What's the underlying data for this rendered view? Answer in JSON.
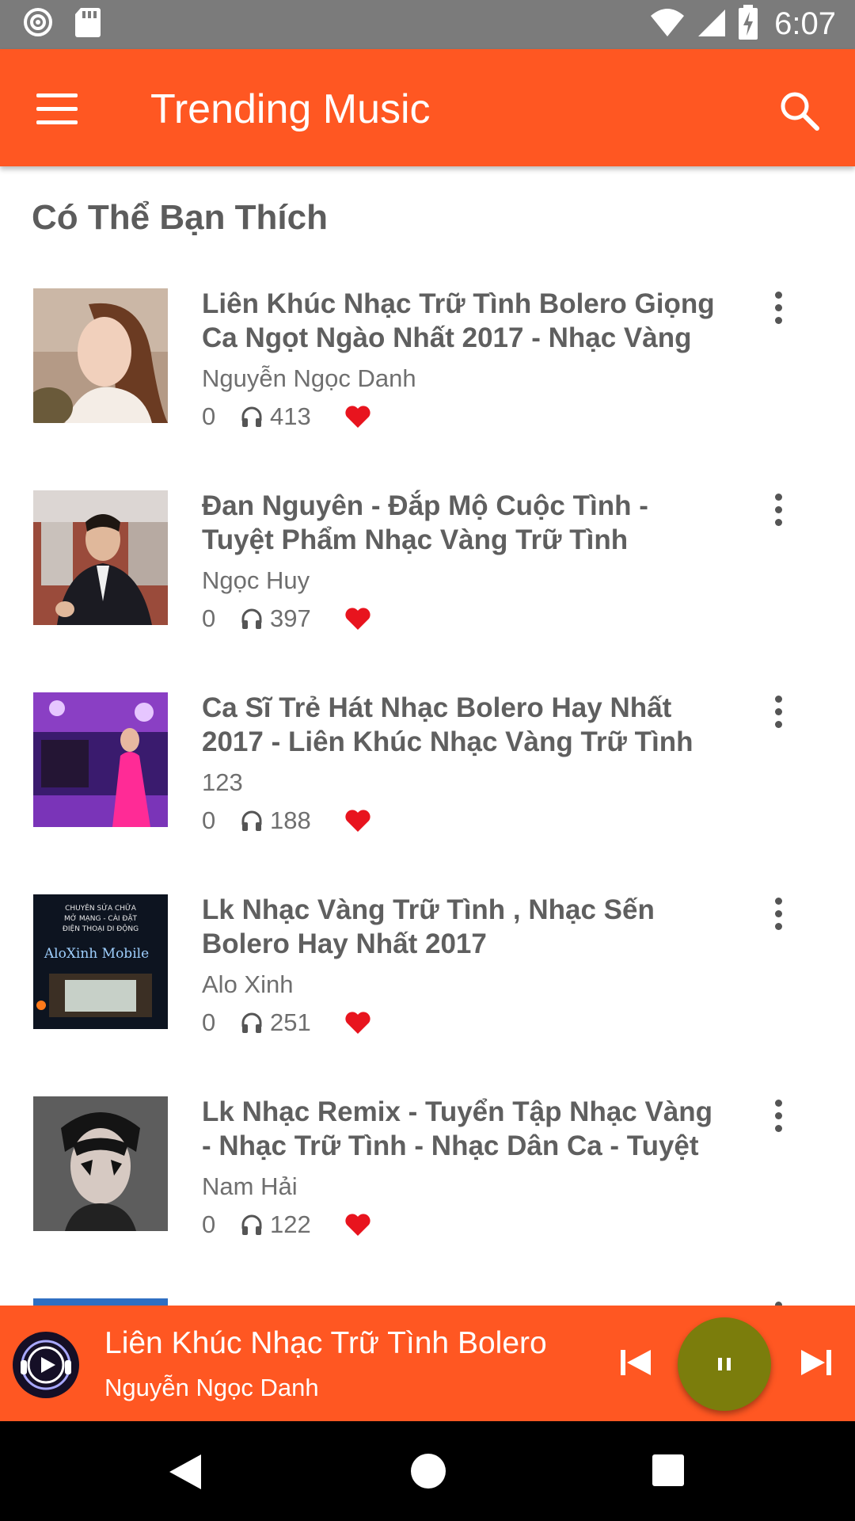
{
  "status_bar": {
    "time": "6:07",
    "icons": [
      "podcast-icon",
      "sd-card-icon",
      "wifi-icon",
      "signal-icon",
      "battery-charging-icon"
    ]
  },
  "app_bar": {
    "title": "Trending Music",
    "menu_icon": "hamburger-icon",
    "search_icon": "search-icon",
    "color": "#ff5722"
  },
  "section": {
    "title": "Có Thể Bạn Thích"
  },
  "songs": [
    {
      "title": "Liên Khúc Nhạc Trữ Tình Bolero Giọng Ca Ngọt Ngào Nhất 2017 - Nhạc Vàng",
      "artist": "Nguyễn Ngọc Danh",
      "likes": "0",
      "plays": "413"
    },
    {
      "title": "Đan Nguyên - Đắp Mộ Cuộc Tình - Tuyệt Phẩm Nhạc Vàng Trữ Tình",
      "artist": "Ngọc Huy",
      "likes": "0",
      "plays": "397"
    },
    {
      "title": "Ca Sĩ Trẻ Hát Nhạc Bolero Hay Nhất 2017 - Liên Khúc Nhạc Vàng Trữ Tình",
      "artist": "123",
      "likes": "0",
      "plays": "188"
    },
    {
      "title": "Lk Nhạc Vàng Trữ Tình , Nhạc Sến Bolero Hay Nhất 2017",
      "artist": "Alo Xinh",
      "likes": "0",
      "plays": "251",
      "thumb_text": [
        "CHUYÊN SỬA CHỮA",
        "MỞ MẠNG - CÀI ĐẶT",
        "ĐIỆN THOẠI DI ĐỘNG",
        "AloXinh Mobile"
      ]
    },
    {
      "title": "Lk Nhạc Remix - Tuyển Tập Nhạc Vàng - Nhạc Trữ Tình - Nhạc Dân Ca - Tuyệt",
      "artist": "Nam Hải",
      "likes": "0",
      "plays": "122"
    }
  ],
  "now_playing": {
    "title": "Liên Khúc Nhạc Trữ Tình Bolero",
    "artist": "Nguyễn Ngọc Danh",
    "pause_color": "#7b7d0c"
  },
  "nav_bar": {
    "icons": [
      "back-icon",
      "home-icon",
      "recents-icon"
    ]
  },
  "colors": {
    "accent": "#ff5722",
    "heart": "#e8141e"
  }
}
